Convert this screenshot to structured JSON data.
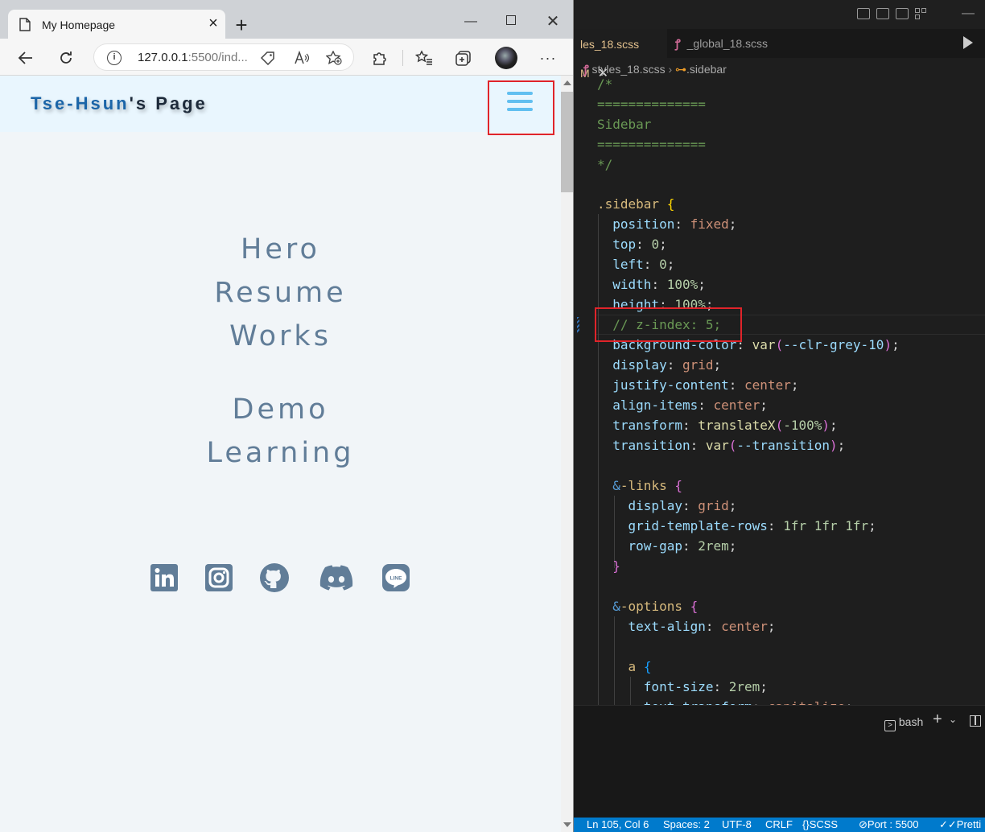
{
  "browser": {
    "tab_title": "My Homepage",
    "address_host": "127.0.0.1",
    "address_rest": ":5500/ind...",
    "info_glyph": "i"
  },
  "page": {
    "logo_first": "Tse-Hsun",
    "logo_rest": "'s Page",
    "links": [
      "Hero",
      "Resume",
      "Works",
      "Demo",
      "Learning"
    ],
    "socials": [
      "linkedin-icon",
      "instagram-icon",
      "github-icon",
      "discord-icon",
      "line-icon"
    ],
    "line_label": "LINE",
    "accent_color": "#62bff0",
    "link_color": "#617d98"
  },
  "editor": {
    "tab_active": "les_18.scss",
    "tab_active_status": "M",
    "tab_inactive": "_global_18.scss",
    "breadcrumb_file": "styles_18.scss",
    "breadcrumb_symbol": ".sidebar",
    "terminal_label": "bash"
  },
  "statusbar": {
    "position": "Ln 105, Col 6",
    "spaces": "Spaces: 2",
    "encoding": "UTF-8",
    "eol": "CRLF",
    "language": "SCSS",
    "port": "Port : 5500",
    "prettier": "Pretti"
  }
}
